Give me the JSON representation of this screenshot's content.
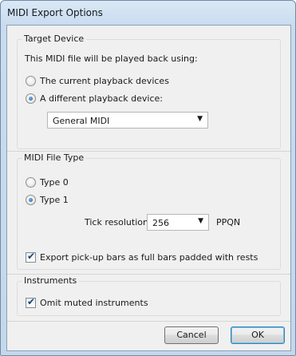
{
  "window": {
    "title": "MIDI Export Options"
  },
  "target_device": {
    "group_title": "Target Device",
    "description": "This MIDI file will be played back using:",
    "option_current": "The current playback devices",
    "option_different": "A different playback device:",
    "selected_option": "different",
    "device_value": "General MIDI"
  },
  "midi_file_type": {
    "group_title": "MIDI File Type",
    "option_type0": "Type 0",
    "option_type1": "Type 1",
    "selected_option": "Type 1",
    "tick_label": "Tick resolution:",
    "tick_value": "256",
    "tick_unit": "PPQN",
    "pickup_label": "Export pick-up bars as full bars padded with rests",
    "pickup_checked": true
  },
  "instruments": {
    "group_title": "Instruments",
    "omit_label": "Omit muted instruments",
    "omit_checked": true
  },
  "buttons": {
    "cancel": "Cancel",
    "ok": "OK"
  },
  "icons": {
    "dropdown": "chevron-down-icon",
    "check": "checkmark-icon"
  },
  "colors": {
    "accent": "#1d5aa8",
    "default_button_border": "#3c7fb1"
  }
}
